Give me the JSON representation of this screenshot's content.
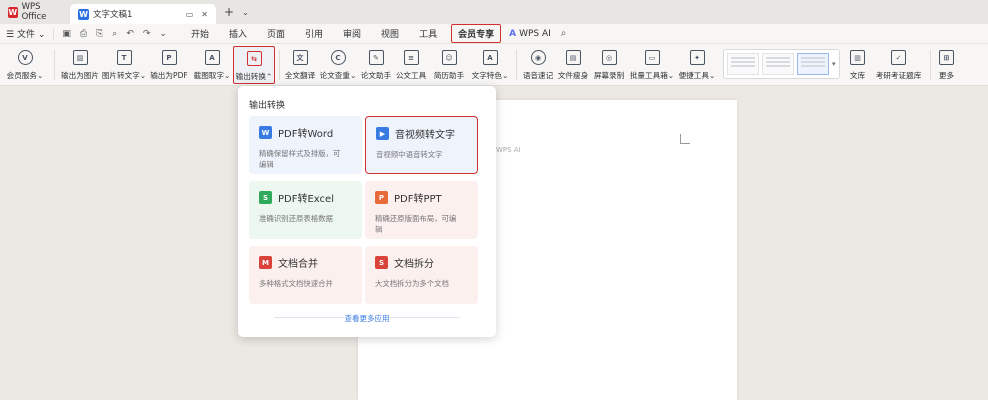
{
  "titlebar": {
    "wps_tab": "WPS Office",
    "doc_tab": "文字文稿1"
  },
  "menubar": {
    "file": "文件",
    "items": [
      "开始",
      "插入",
      "页面",
      "引用",
      "审阅",
      "视图",
      "工具"
    ],
    "member": "会员专享",
    "ai": "WPS AI"
  },
  "ribbon": {
    "items": [
      "会员服务",
      "输出为图片",
      "图片转文字",
      "输出为PDF",
      "截图取字",
      "输出转换",
      "全文翻译",
      "论文查重",
      "论文助手",
      "公文工具",
      "简历助手",
      "文字特色",
      "语音速记",
      "文件瘦身",
      "屏幕录制",
      "批量工具箱",
      "便捷工具",
      "文库",
      "考研考证题库",
      "更多"
    ]
  },
  "document": {
    "hint": "WPS AI"
  },
  "dropdown": {
    "title": "输出转换",
    "cards": [
      {
        "title": "PDF转Word",
        "desc1": "精确保留样式及排版，可",
        "desc2": "编辑"
      },
      {
        "title": "音视频转文字",
        "desc1": "音视频中语音转文字",
        "desc2": ""
      },
      {
        "title": "PDF转Excel",
        "desc1": "准确识别还原表格数据",
        "desc2": ""
      },
      {
        "title": "PDF转PPT",
        "desc1": "精确还原版面布局，可编",
        "desc2": "辑"
      },
      {
        "title": "文档合并",
        "desc1": "多种格式文档快速合并",
        "desc2": ""
      },
      {
        "title": "文档拆分",
        "desc1": "大文档拆分为多个文档",
        "desc2": ""
      }
    ],
    "more": "查看更多应用"
  }
}
